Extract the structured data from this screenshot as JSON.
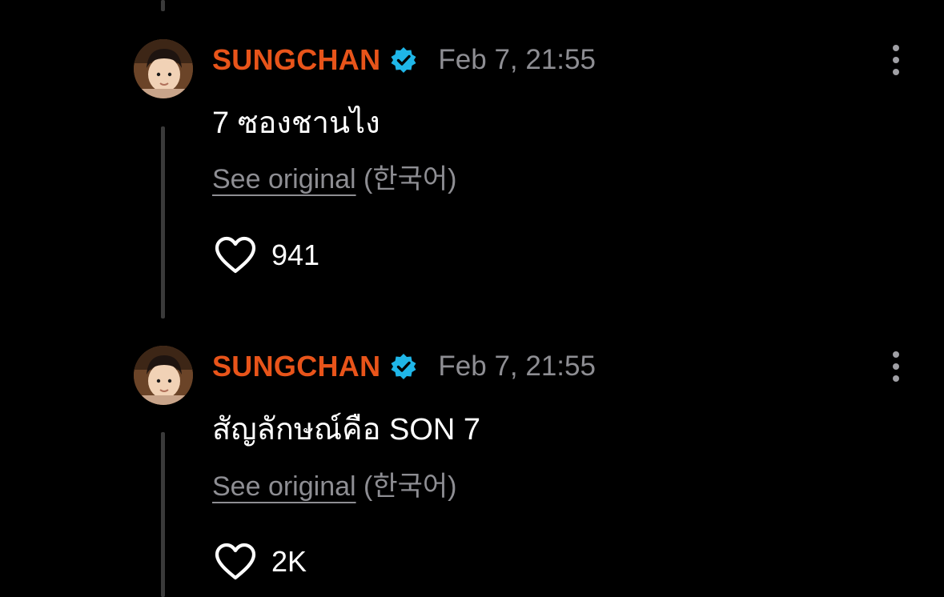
{
  "posts": [
    {
      "username": "SUNGCHAN",
      "timestamp": "Feb 7, 21:55",
      "text": "7 ซองชานไง",
      "see_original": "See original",
      "original_language": "(한국어)",
      "likes": "941"
    },
    {
      "username": "SUNGCHAN",
      "timestamp": "Feb 7, 21:55",
      "text": "สัญลักษณ์คือ SON 7",
      "see_original": "See original",
      "original_language": "(한국어)",
      "likes": "2K"
    }
  ],
  "colors": {
    "username": "#e8541a",
    "verified_badge": "#1fb6e8",
    "muted_text": "#8e8e93",
    "background": "#000000"
  },
  "icons": {
    "verified": "verified-badge-icon",
    "more": "more-vertical-icon",
    "like": "heart-outline-icon"
  }
}
